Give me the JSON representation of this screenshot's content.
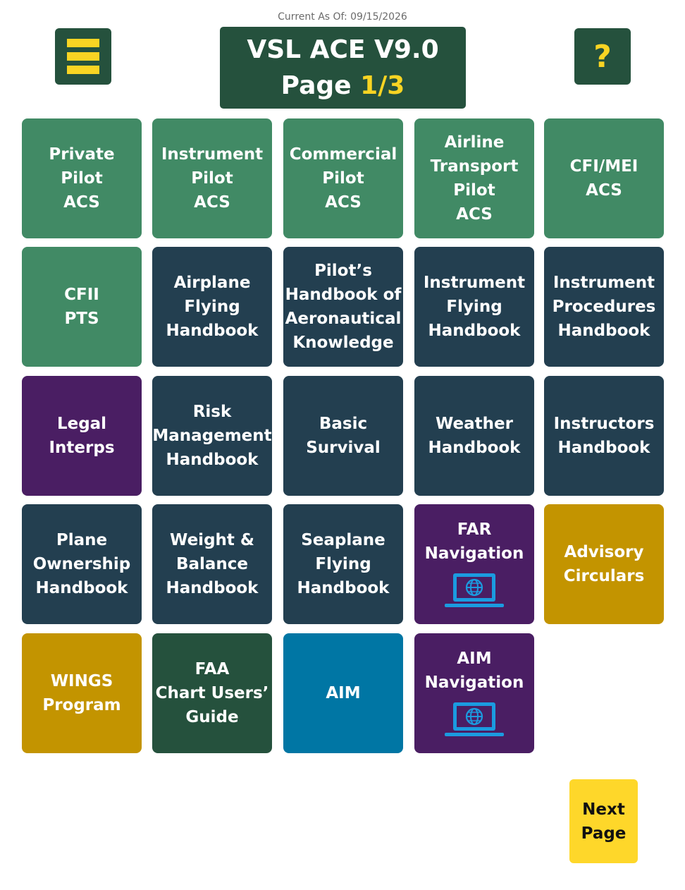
{
  "header": {
    "current_as_of": "Current As Of: 09/15/2026",
    "title": "VSL ACE V9.0",
    "page_prefix": "Page ",
    "page_number": "1/3",
    "menu_icon": "hamburger-menu-icon",
    "help_label": "?"
  },
  "colors": {
    "acs_green": "#418a65",
    "handbook_navy": "#233f50",
    "legal_purple": "#4a1e63",
    "gold": "#c39400",
    "dark_green": "#25513d",
    "aim_teal": "#0076a4",
    "accent_yellow": "#f9d423"
  },
  "tiles": [
    {
      "lines": [
        "Private",
        "Pilot",
        "ACS"
      ]
    },
    {
      "lines": [
        "Instrument",
        "Pilot",
        "ACS"
      ]
    },
    {
      "lines": [
        "Commercial",
        "Pilot",
        "ACS"
      ]
    },
    {
      "lines": [
        "Airline",
        "Transport",
        "Pilot",
        "ACS"
      ]
    },
    {
      "lines": [
        "CFI/MEI",
        "ACS"
      ]
    },
    {
      "lines": [
        "CFII",
        "PTS"
      ]
    },
    {
      "lines": [
        "Airplane",
        "Flying",
        "Handbook"
      ]
    },
    {
      "lines": [
        "Pilot’s",
        "Handbook of",
        "Aeronautical",
        "Knowledge"
      ]
    },
    {
      "lines": [
        "Instrument",
        "Flying",
        "Handbook"
      ]
    },
    {
      "lines": [
        "Instrument",
        "Procedures",
        "Handbook"
      ]
    },
    {
      "lines": [
        "Legal",
        "Interps"
      ]
    },
    {
      "lines": [
        "Risk",
        "Management",
        "Handbook"
      ]
    },
    {
      "lines": [
        "Basic",
        "Survival"
      ]
    },
    {
      "lines": [
        "Weather",
        "Handbook"
      ]
    },
    {
      "lines": [
        "Instructors",
        "Handbook"
      ]
    },
    {
      "lines": [
        "Plane",
        "Ownership",
        "Handbook"
      ]
    },
    {
      "lines": [
        "Weight &",
        "Balance",
        "Handbook"
      ]
    },
    {
      "lines": [
        "Seaplane",
        "Flying",
        "Handbook"
      ]
    },
    {
      "lines": [
        "FAR",
        "Navigation"
      ],
      "icon": "laptop-globe-icon"
    },
    {
      "lines": [
        "Advisory",
        "Circulars"
      ]
    },
    {
      "lines": [
        "WINGS",
        "Program"
      ]
    },
    {
      "lines": [
        "FAA",
        "Chart Users’",
        "Guide"
      ]
    },
    {
      "lines": [
        "AIM"
      ]
    },
    {
      "lines": [
        "AIM",
        "Navigation"
      ],
      "icon": "laptop-globe-icon"
    }
  ],
  "next_button": {
    "lines": [
      "Next",
      "Page"
    ]
  }
}
